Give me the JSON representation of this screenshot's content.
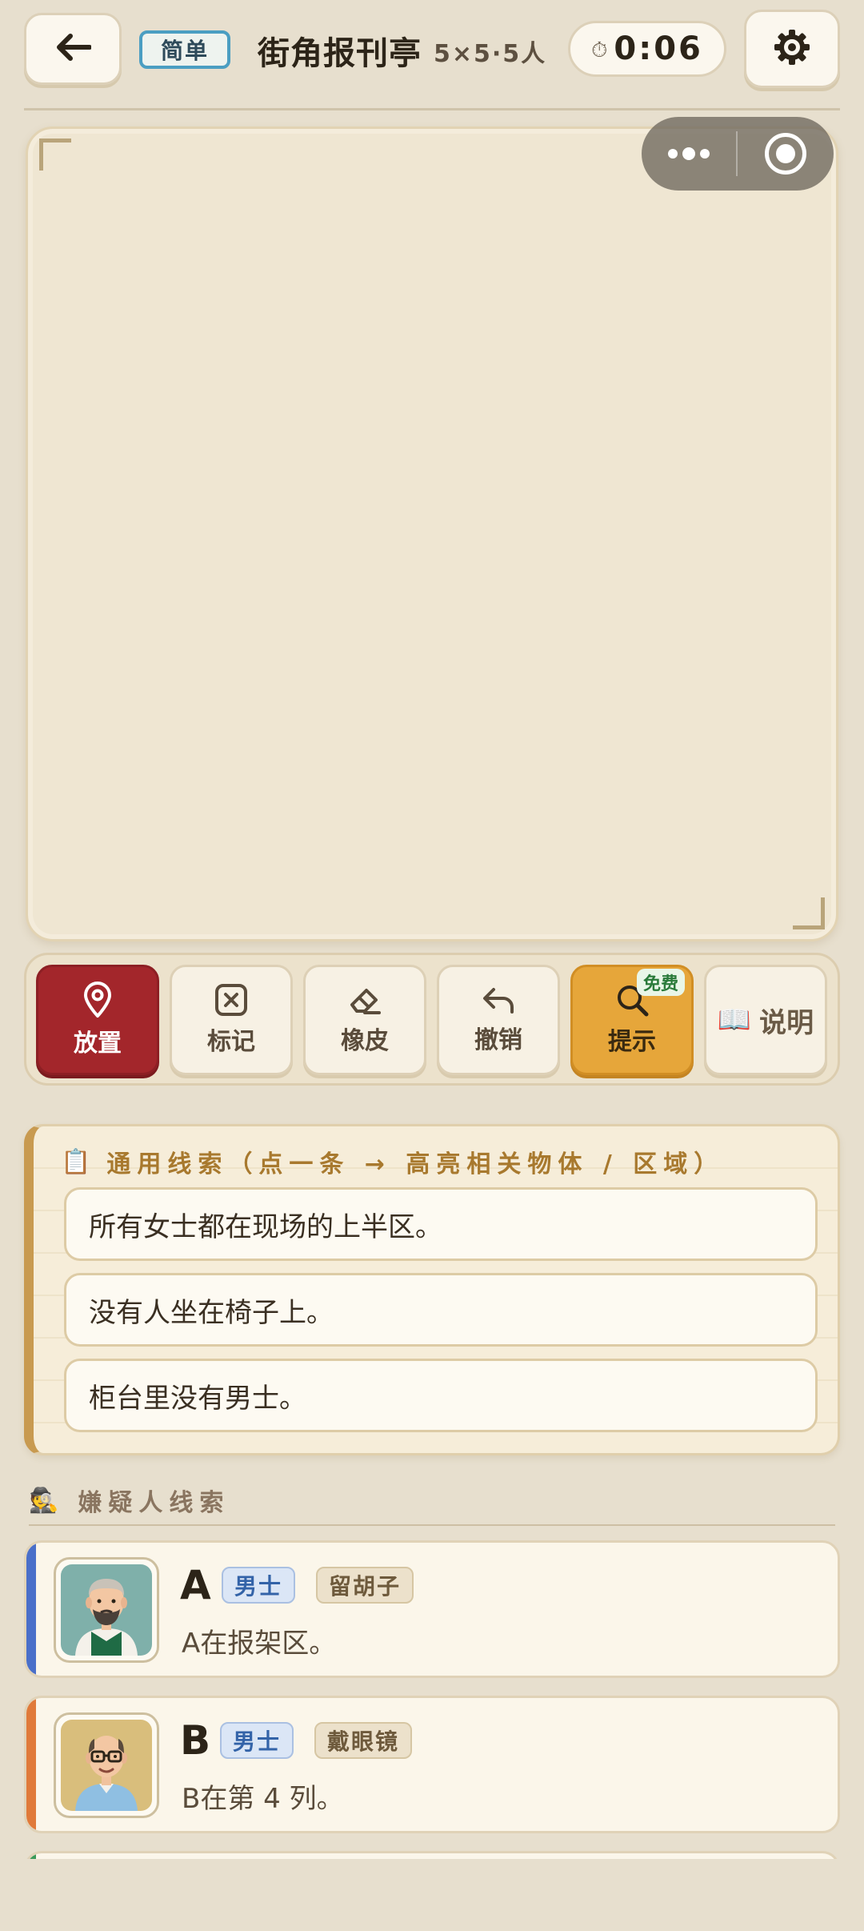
{
  "header": {
    "difficulty": "简单",
    "title": "街角报刊亭",
    "subtitle": "5×5·5人",
    "timer_icon": "⏱",
    "timer": "0:06"
  },
  "toolbar": {
    "place_label": "放置",
    "mark_label": "标记",
    "eraser_label": "橡皮",
    "undo_label": "撤销",
    "hint_label": "提示",
    "hint_badge": "免费",
    "explain_icon": "📖",
    "explain_label": "说明"
  },
  "general_clues": {
    "icon": "📋",
    "heading": "通用线索（点一条 → 高亮相关物体 / 区域）",
    "items": [
      "所有女士都在现场的上半区。",
      "没有人坐在椅子上。",
      "柜台里没有男士。"
    ]
  },
  "suspects": {
    "icon": "🕵",
    "heading": "嫌疑人线索",
    "items": [
      {
        "letter": "A",
        "gender": "男士",
        "trait": "留胡子",
        "clue": "A在报架区。",
        "accent": "#4a6fc9"
      },
      {
        "letter": "B",
        "gender": "男士",
        "trait": "戴眼镜",
        "clue": "B在第 4 列。",
        "accent": "#e07a3a"
      }
    ]
  },
  "colors": {
    "background": "#e7dfce",
    "place_active": "#a3262b",
    "hint": "#e6a63a",
    "difficulty_border": "#4b9ec2",
    "next_card_accent": "#3a9a5a"
  }
}
